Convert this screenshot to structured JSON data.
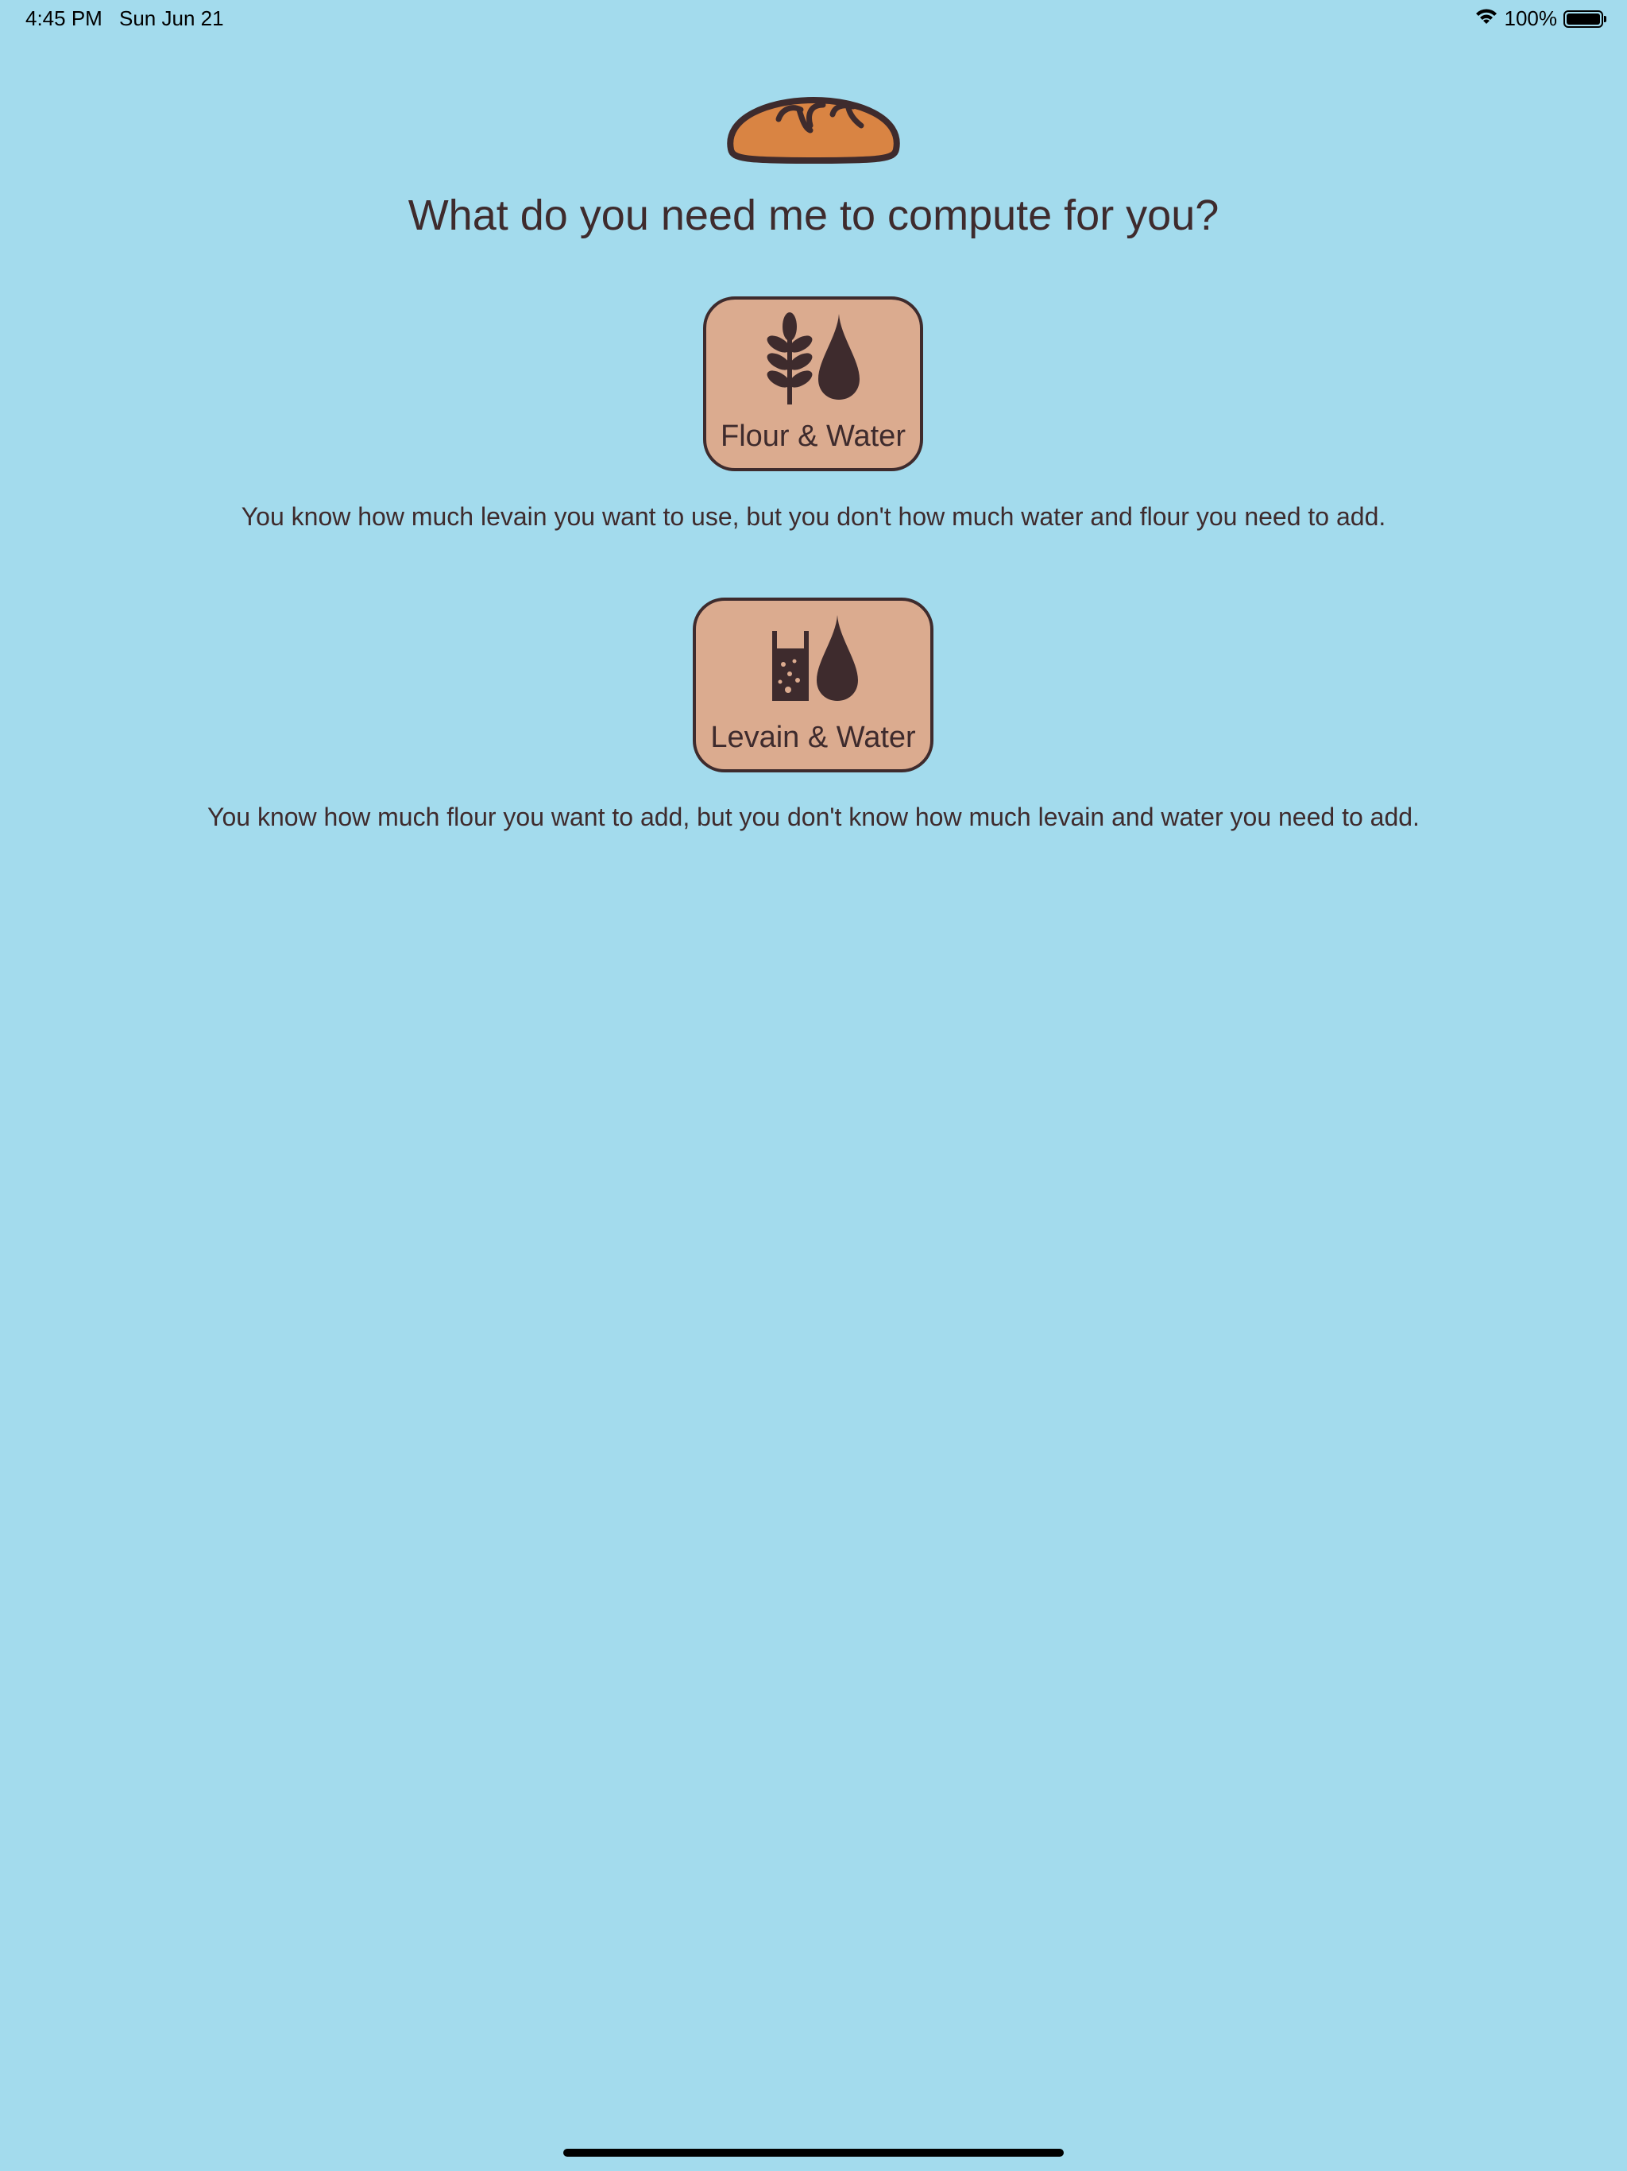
{
  "status_bar": {
    "time": "4:45 PM",
    "date": "Sun Jun 21",
    "battery": "100%",
    "wifi_icon": "wifi-icon",
    "battery_icon": "battery-icon"
  },
  "header": {
    "logo_icon": "bread-icon",
    "title": "What do you need me to compute for you?"
  },
  "options": [
    {
      "label": "Flour & Water",
      "icons": [
        "wheat-icon",
        "water-drop-icon"
      ],
      "description": "You know how much levain you want to use, but you don't how much water and flour you need to add."
    },
    {
      "label": "Levain & Water",
      "icons": [
        "levain-jar-icon",
        "water-drop-icon"
      ],
      "description": "You know how much flour you want to add, but you don't know how much levain and water you need to add."
    }
  ],
  "colors": {
    "background": "#a3dbed",
    "button_fill": "#dbab8f",
    "text_dark": "#3e2b2d",
    "bread": "#d98443"
  }
}
